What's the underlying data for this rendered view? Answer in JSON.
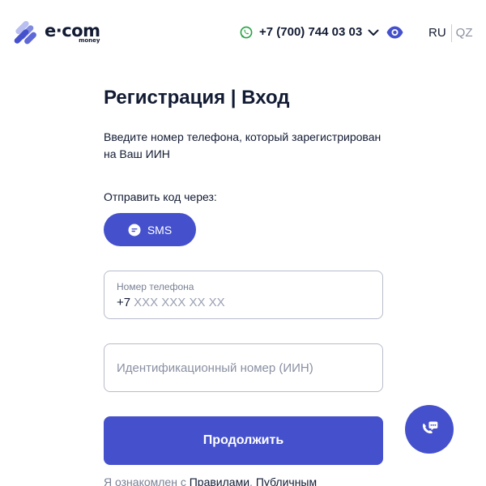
{
  "header": {
    "logo": {
      "word": "e·com",
      "sub": "money",
      "icon": "ecom-logo-icon"
    },
    "phone": {
      "icon": "whatsapp-icon",
      "number": "+7 (700) 744 03 03",
      "dropdown_icon": "chevron-down-icon"
    },
    "accessibility_icon": "eye-icon",
    "languages": {
      "active": "RU",
      "other": "QZ"
    }
  },
  "main": {
    "title": "Регистрация | Вход",
    "description": "Введите номер телефона, который зарегистрирован на Ваш ИИН",
    "send_via_label": "Отправить код через:",
    "sms_button": {
      "label": "SMS",
      "icon": "message-icon"
    },
    "phone_field": {
      "label": "Номер телефона",
      "prefix": "+7",
      "placeholder": "XXX XXX XX XX"
    },
    "iin_field": {
      "placeholder": "Идентификационный номер (ИИН)"
    },
    "submit_label": "Продолжить",
    "consent": {
      "prefix": "Я ознакомлен с ",
      "link1": "Правилами",
      "separator": ", ",
      "link2": "Публичным"
    }
  },
  "support_fab": {
    "icon": "phone-chat-icon"
  },
  "colors": {
    "accent": "#4551cc",
    "text": "#121b33",
    "muted": "#7a8094",
    "whatsapp": "#25a244"
  }
}
